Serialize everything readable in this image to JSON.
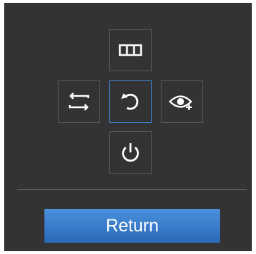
{
  "controls": {
    "up": {
      "icon": "columns-icon"
    },
    "left": {
      "icon": "switch-arrows-icon"
    },
    "center": {
      "icon": "rotate-icon",
      "selected": true
    },
    "right": {
      "icon": "eye-plus-icon"
    },
    "down": {
      "icon": "power-icon"
    }
  },
  "return_label": "Return",
  "colors": {
    "panel_bg": "#333333",
    "button_border": "#5a5a5a",
    "selected_border": "#3d86d8",
    "return_bg": "#3b7fd0",
    "icon_color": "#ffffff"
  }
}
